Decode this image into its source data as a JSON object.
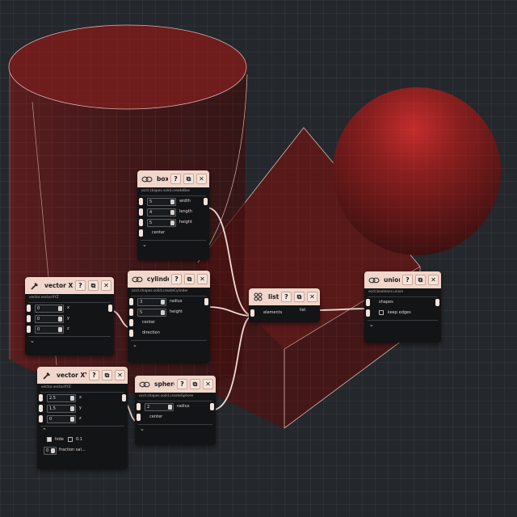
{
  "colors": {
    "background": "#24272b",
    "node_header": "#f0d6cb",
    "node_body": "#121416",
    "solid": "#5a1616",
    "wire": "#f1dcd3"
  },
  "nodes": {
    "box": {
      "title": "box",
      "desc": "occt.shapes.solid.createBox",
      "width": "5",
      "width_label": "width",
      "length": "4",
      "length_label": "length",
      "height": "5",
      "height_label": "height",
      "center_label": "center"
    },
    "cylinder": {
      "title": "cylinder",
      "desc": "occt.shapes.solid.createCylinder",
      "radius": "3",
      "radius_label": "radius",
      "height": "5",
      "height_label": "height",
      "center_label": "center",
      "direction_label": "direction"
    },
    "vector1": {
      "title": "vector XYZ",
      "desc": "vector.vectorXYZ",
      "x": "0",
      "x_label": "x",
      "y": "0",
      "y_label": "y",
      "z": "0",
      "z_label": "z"
    },
    "vector2": {
      "title": "vector XYZ",
      "desc": "vector.vectorXYZ",
      "x": "2.5",
      "x_label": "x",
      "y": "1.5",
      "y_label": "y",
      "z": "0",
      "z_label": "z",
      "toggle1_label": "hide",
      "toggle2_label": "0.1",
      "stepper": "0",
      "stepper_label": "fraction sal..."
    },
    "sphere": {
      "title": "sphere",
      "desc": "occt.shapes.solid.createSphere",
      "radius": "2",
      "radius_label": "radius",
      "center_label": "center"
    },
    "list": {
      "title": "list",
      "elements_label": "elements",
      "out_label": "list"
    },
    "union": {
      "title": "union",
      "desc": "occt.booleans.union",
      "shapes_label": "shapes",
      "keep_edges_label": "keep edges",
      "keep_edges": false
    }
  }
}
